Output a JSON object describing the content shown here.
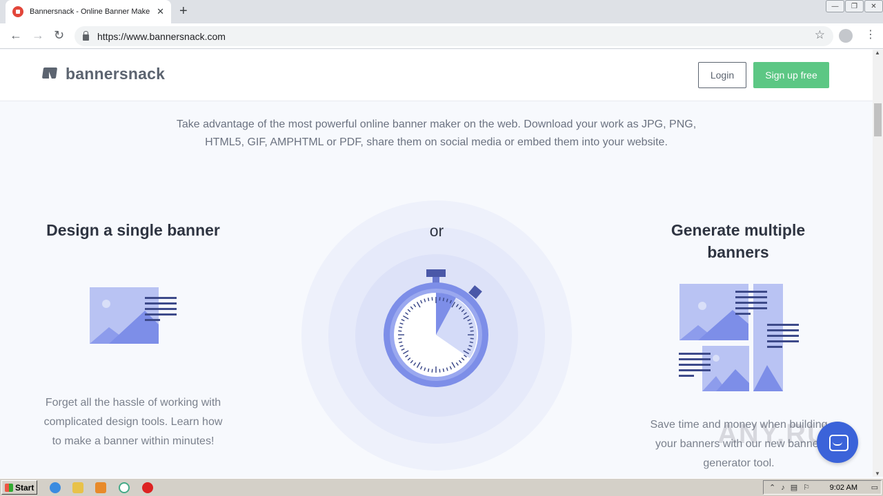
{
  "browser": {
    "tab_title": "Bannersnack - Online Banner Maker, ",
    "tab_close": "✕",
    "new_tab": "+",
    "url": "https://www.bannersnack.com",
    "back": "←",
    "forward": "→",
    "reload": "↻",
    "star": "☆",
    "menu": "⋮",
    "win_minimize": "—",
    "win_restore": "❐",
    "win_close": "✕"
  },
  "site": {
    "logo_text": "bannersnack",
    "login_label": "Login",
    "signup_label": "Sign up free",
    "intro_text": "Take advantage of the most powerful online banner maker on the web. Download your work as JPG, PNG, HTML5, GIF, AMPHTML or PDF, share them on social media or embed them into your website.",
    "single": {
      "title": "Design a single banner",
      "text": "Forget all the hassle of working with complicated design tools. Learn how to make a banner within minutes!"
    },
    "or_label": "or",
    "multiple": {
      "title": "Generate multiple banners",
      "text": "Save time and money when building your banners with our new banner generator tool."
    },
    "watermark": "ANY.RUN"
  },
  "taskbar": {
    "start_label": "Start",
    "clock": "9:02 AM"
  },
  "colors": {
    "accent_green": "#5cc784",
    "illustration_blue": "#7d8ee8",
    "illustration_light": "#b9c3f3",
    "chat_blue": "#3b63d9"
  }
}
